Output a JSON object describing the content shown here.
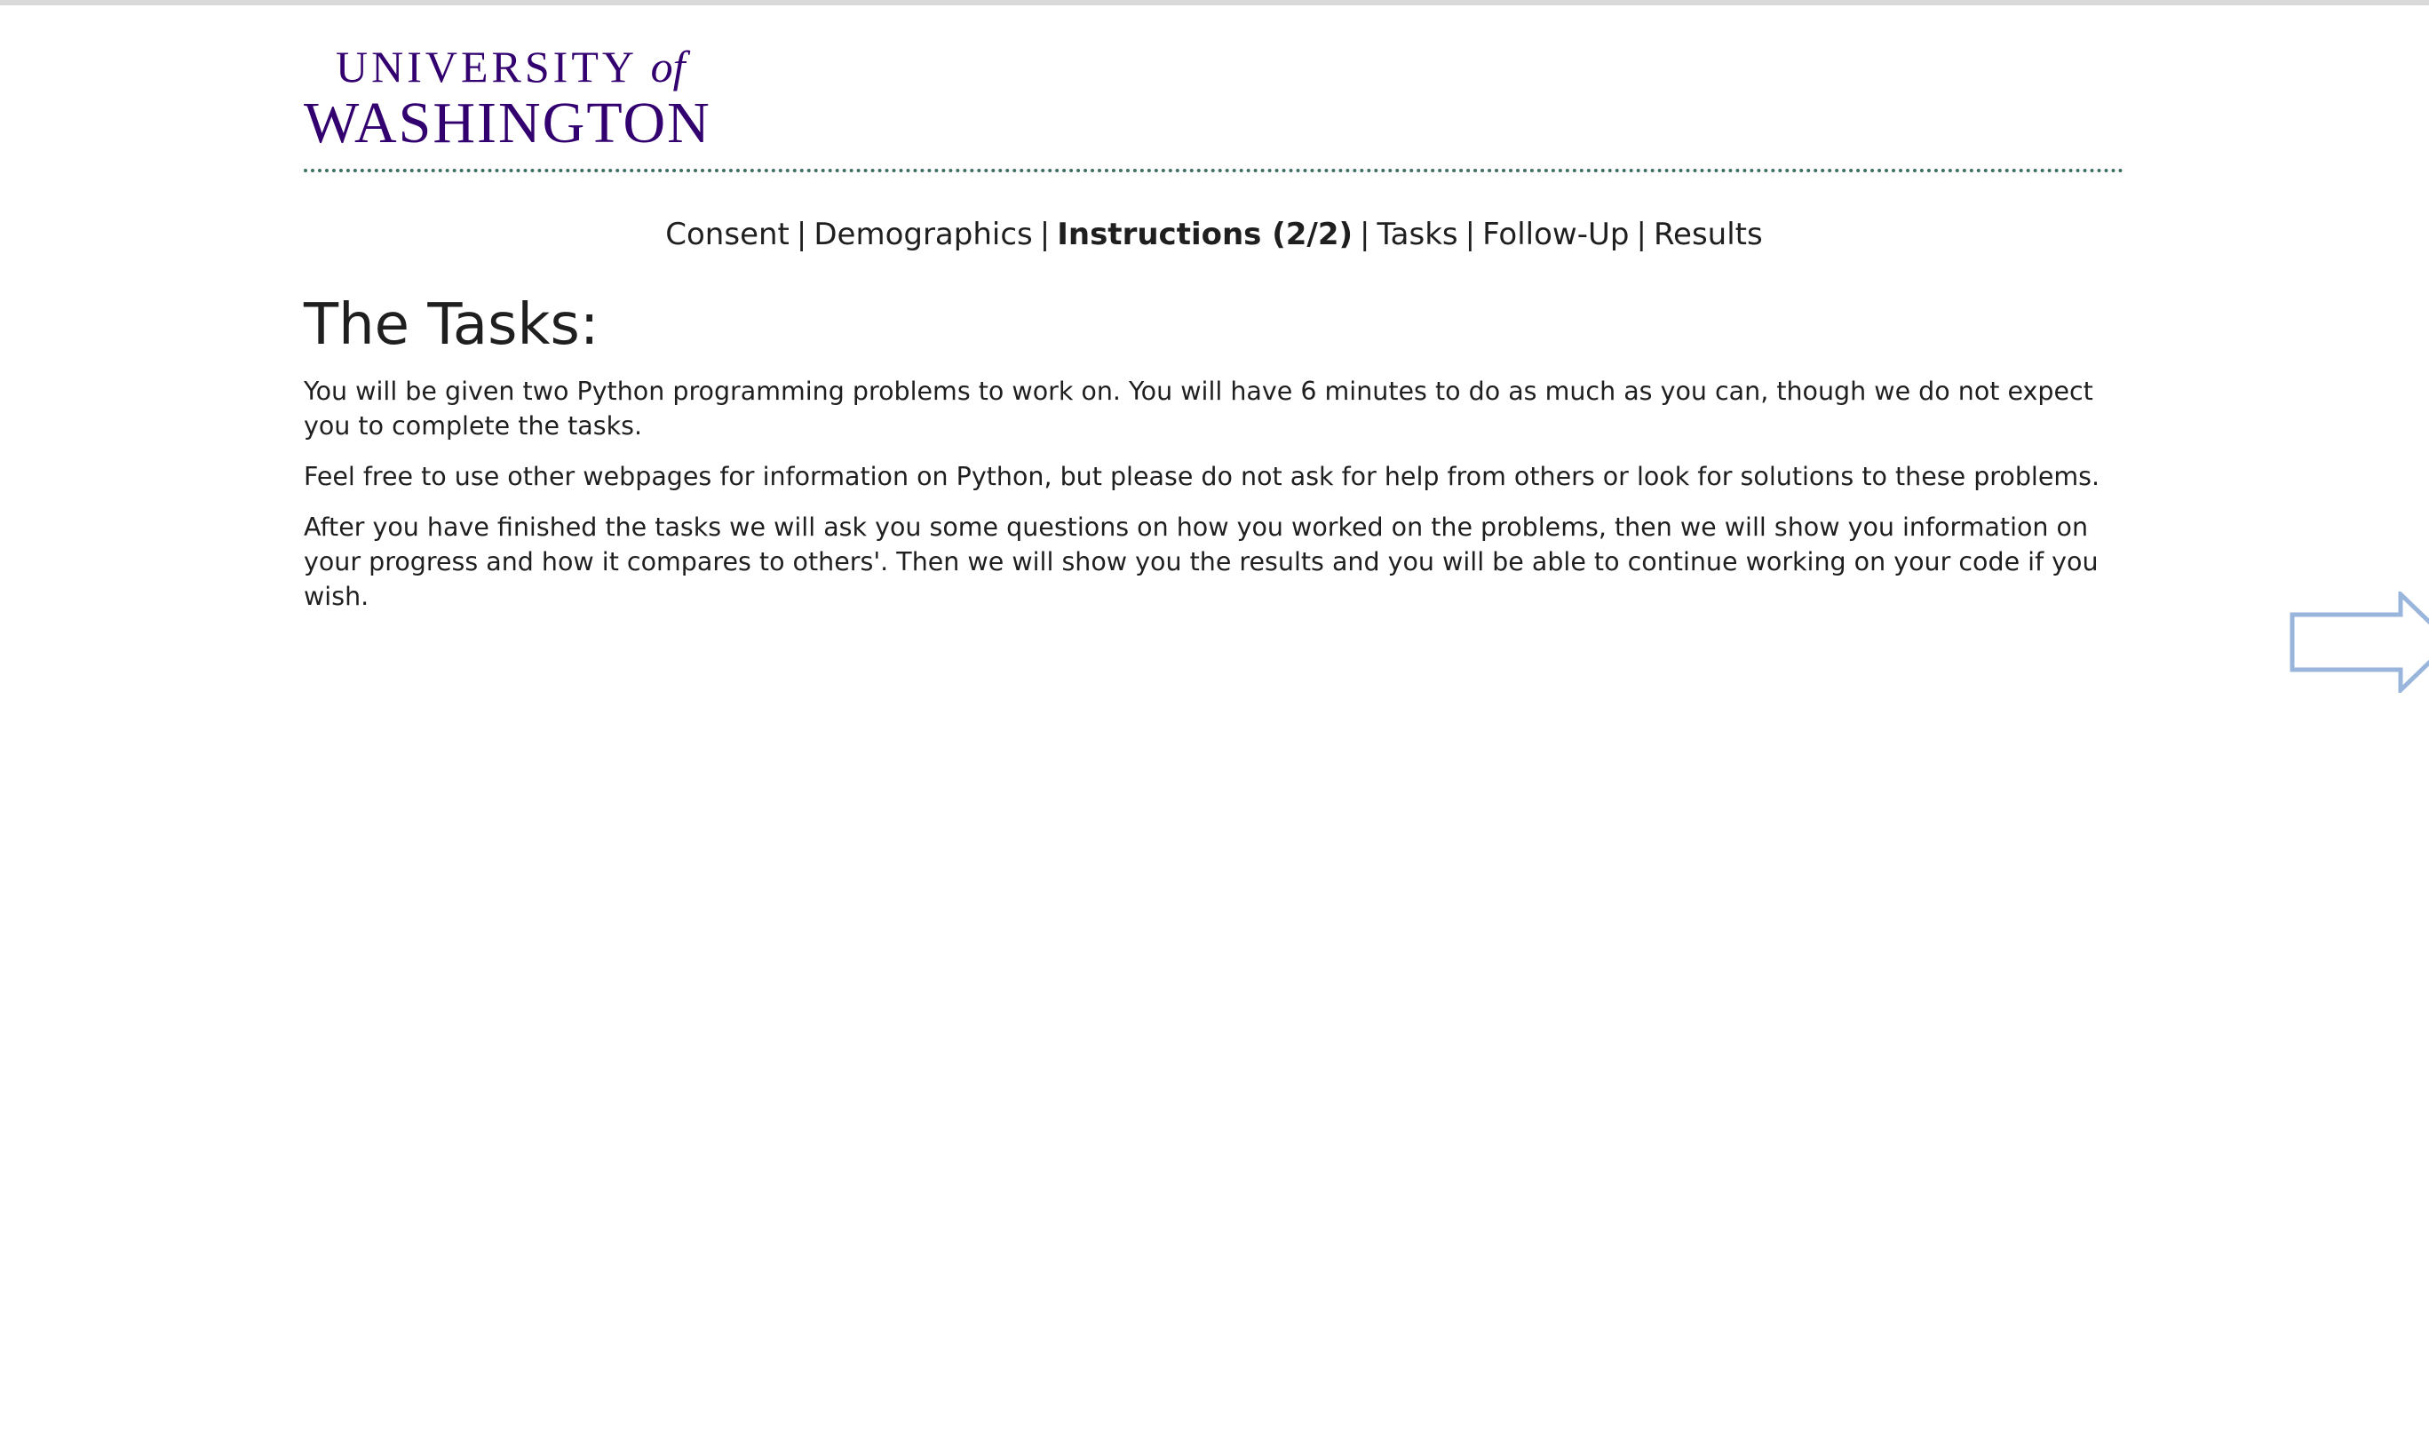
{
  "logo": {
    "line1_main": "UNIVERSITY",
    "line1_of": "of",
    "line2": "WASHINGTON"
  },
  "nav": {
    "steps": [
      {
        "label": "Consent"
      },
      {
        "label": "Demographics"
      },
      {
        "label": "Instructions (2/2)",
        "current": true
      },
      {
        "label": "Tasks"
      },
      {
        "label": "Follow-Up"
      },
      {
        "label": "Results"
      }
    ],
    "separator": "|"
  },
  "main": {
    "heading": "The Tasks:",
    "paragraphs": [
      "You will be given two Python programming problems to work on. You will have 6 minutes to do as much as you can, though we do not expect you to complete the tasks.",
      "Feel free to use other webpages for information on Python, but please do not ask for help from others or look for solutions to these problems.",
      "After you have finished the tasks we will ask you some questions on how you worked on the problems, then we will show you information on your progress and how it compares to others'. Then we will show you the results and you will be able to continue working on your code if you wish."
    ]
  },
  "next_button": {
    "icon": "right-arrow-icon",
    "stroke_color": "#9ab5db"
  },
  "colors": {
    "brand_purple": "#33006f",
    "divider": "#3f6f66"
  }
}
